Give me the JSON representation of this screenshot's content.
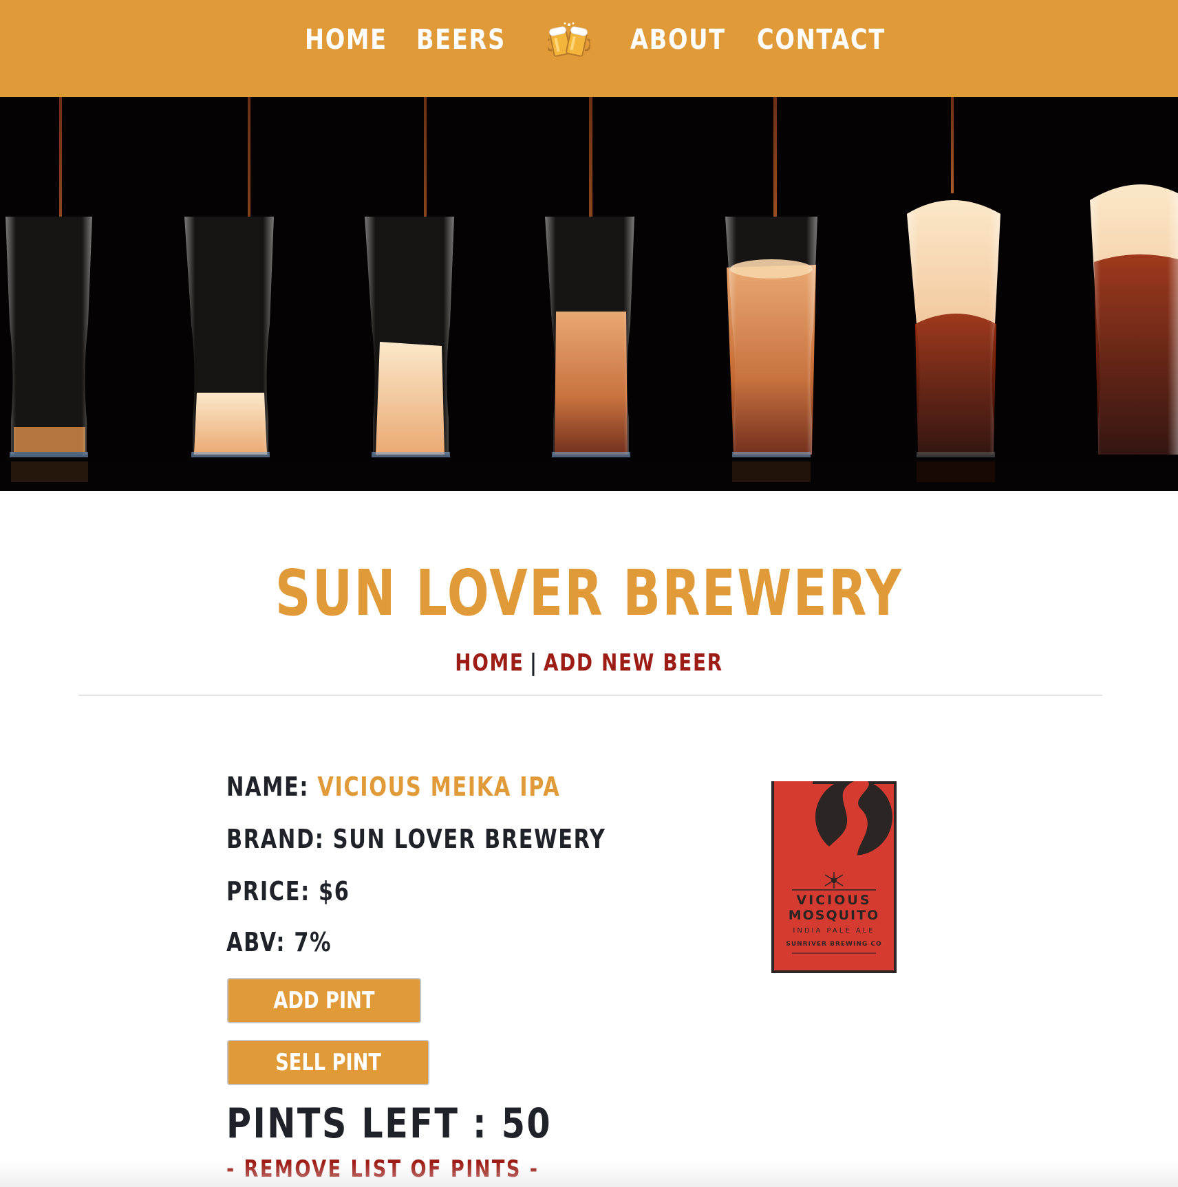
{
  "nav": {
    "home": "HOME",
    "beers": "BEERS",
    "about": "ABOUT",
    "contact": "CONTACT",
    "center_icon": "beer-mugs-icon"
  },
  "hero": {
    "icon": "beer-pouring-glasses-image"
  },
  "header": {
    "title": "SUN LOVER BREWERY",
    "breadcrumb": {
      "home": "HOME",
      "separator": "|",
      "add_new": "ADD NEW BEER"
    }
  },
  "beer": {
    "name_label": "NAME:",
    "name_value": "VICIOUS MEIKA IPA",
    "brand_label": "BRAND:",
    "brand_value": "SUN LOVER BREWERY",
    "price_label": "PRICE:",
    "price_value": "$6",
    "abv_label": "ABV:",
    "abv_value": "7%",
    "add_button": "ADD PINT",
    "sell_button": "SELL PINT",
    "pints_left_label": "PINTS LEFT :",
    "pints_left_value": "50",
    "remove_link": "- REMOVE LIST OF PINTS -"
  },
  "label_image": {
    "line1": "VICIOUS",
    "line2": "MOSQUITO",
    "line3": "INDIA PALE ALE",
    "line4": "SUNRIVER BREWING CO"
  },
  "colors": {
    "accent": "#e09b38",
    "link": "#9e1c16",
    "text": "#1f2329",
    "label_red": "#d63b31"
  }
}
